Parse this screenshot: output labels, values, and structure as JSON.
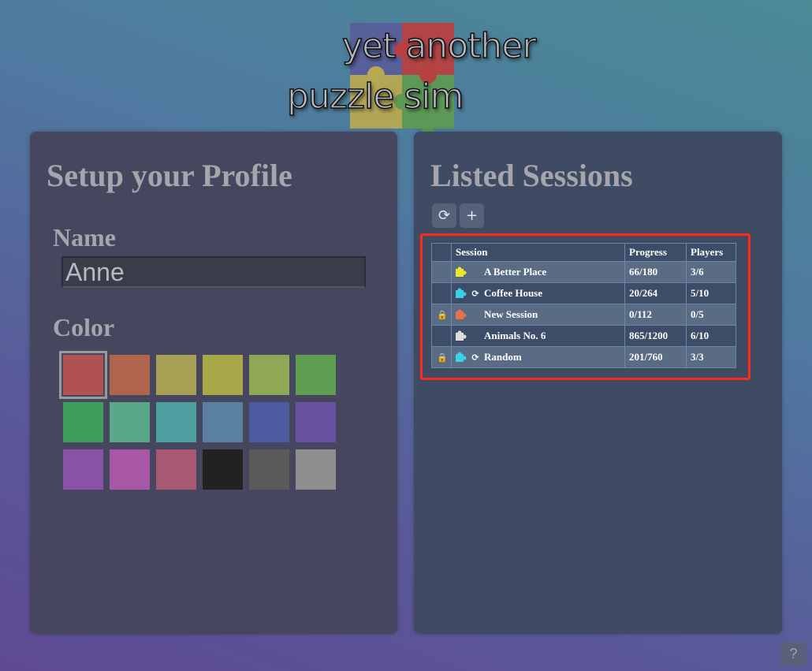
{
  "logo": {
    "line1": "yet another",
    "line2": "puzzle sim",
    "icon": "puzzle-logo-icon"
  },
  "profile": {
    "title": "Setup your Profile",
    "name_label": "Name",
    "name_value": "Anne",
    "color_label": "Color",
    "colors": [
      "#b05252",
      "#b0664c",
      "#a8a055",
      "#a8a848",
      "#8ea856",
      "#5e9e50",
      "#3f9e5a",
      "#5aa88a",
      "#4ea0a0",
      "#5a80a0",
      "#4e5aa0",
      "#6a52a0",
      "#8a52a6",
      "#a856a6",
      "#a85870",
      "#222222",
      "#5a5a5a",
      "#8f8f8f"
    ],
    "selected_color_index": 0
  },
  "sessions": {
    "title": "Listed Sessions",
    "refresh_icon": "refresh-icon",
    "add_icon": "plus-icon",
    "columns": [
      "Session",
      "Progress",
      "Players"
    ],
    "rows": [
      {
        "locked": false,
        "puzzle_color": "#e8e832",
        "refresh": false,
        "name": "A Better Place",
        "progress": "66/180",
        "players": "3/6"
      },
      {
        "locked": false,
        "puzzle_color": "#3ad0e6",
        "refresh": true,
        "name": "Coffee House",
        "progress": "20/264",
        "players": "5/10"
      },
      {
        "locked": true,
        "puzzle_color": "#e8704a",
        "refresh": false,
        "name": "New Session",
        "progress": "0/112",
        "players": "0/5"
      },
      {
        "locked": false,
        "puzzle_color": "#dcdcdc",
        "refresh": false,
        "name": "Animals No. 6",
        "progress": "865/1200",
        "players": "6/10"
      },
      {
        "locked": true,
        "puzzle_color": "#3ad0e6",
        "refresh": true,
        "name": "Random",
        "progress": "201/760",
        "players": "3/3"
      }
    ]
  },
  "help": {
    "label": "?"
  }
}
